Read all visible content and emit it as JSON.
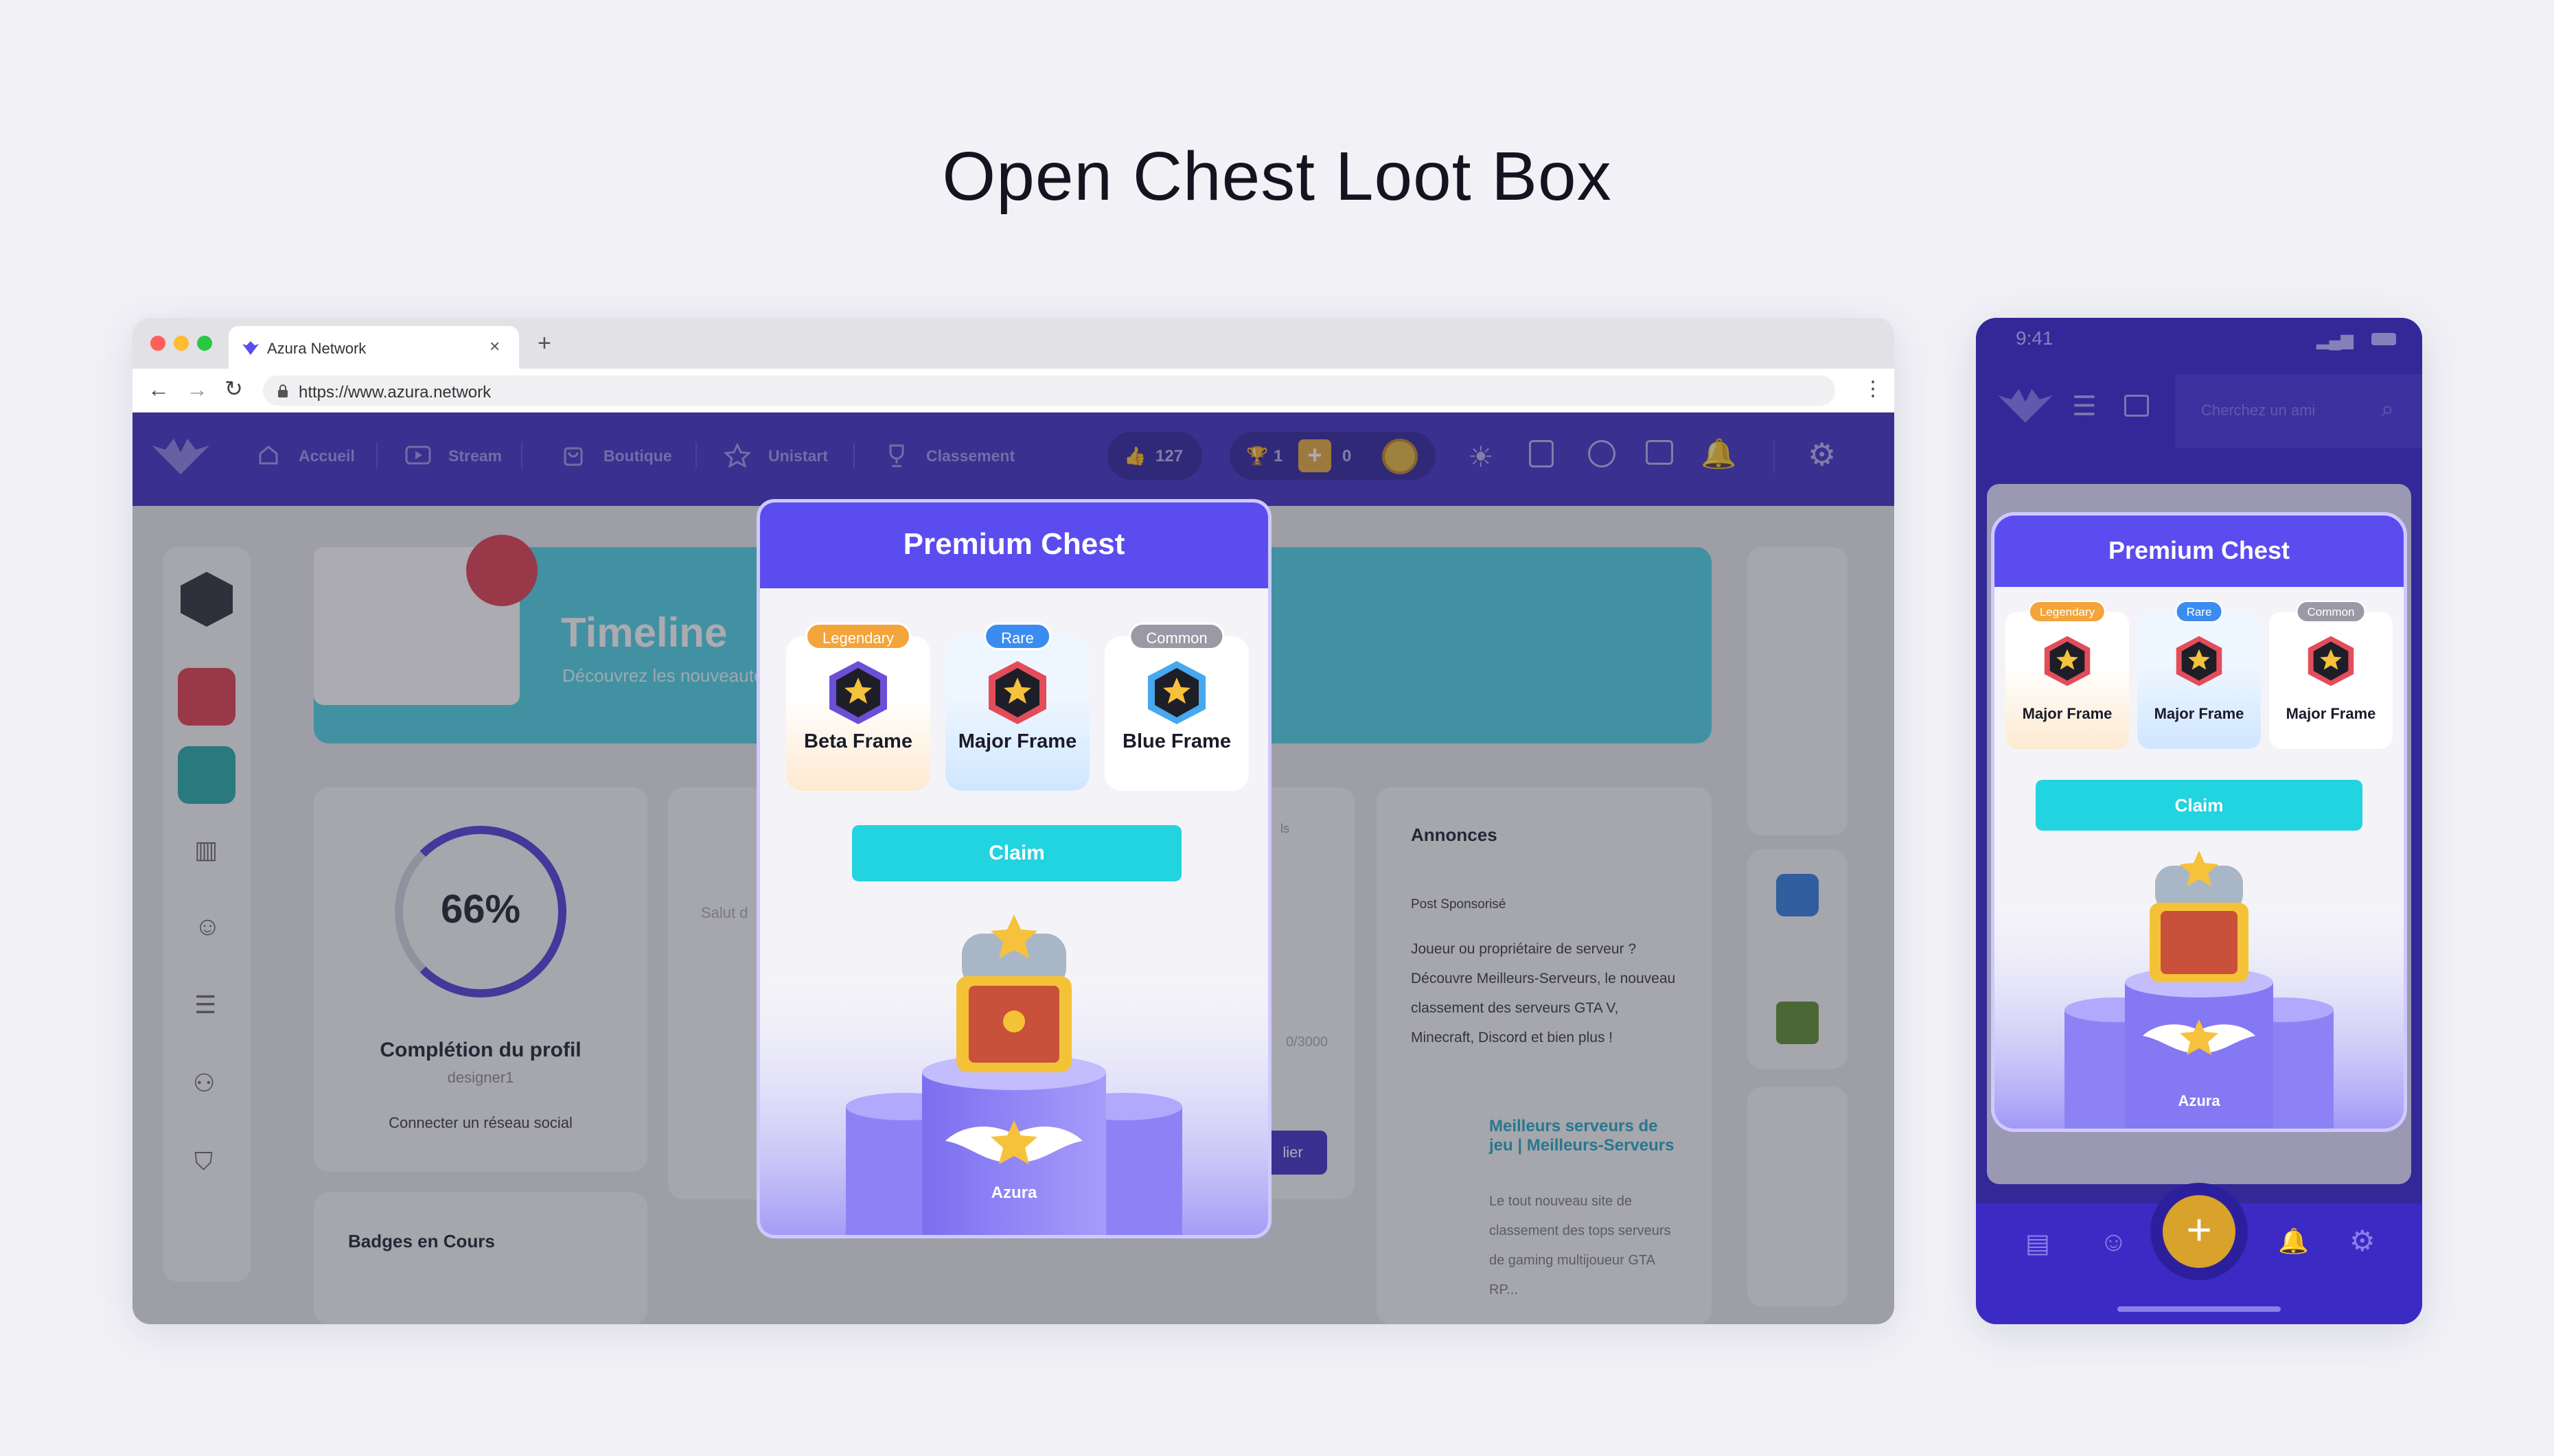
{
  "page": {
    "title": "Open Chest Loot Box"
  },
  "colors": {
    "brand": "#3b2bc4",
    "accent": "#5b4cf0",
    "claim": "#22d3e0",
    "legendary": "#f3a43a",
    "rare": "#3b8cf0",
    "common": "#9a9aa6"
  },
  "browser": {
    "tab_title": "Azura Network",
    "url": "https://www.azura.network",
    "nav": [
      {
        "label": "Accueil",
        "icon": "home-icon"
      },
      {
        "label": "Stream",
        "icon": "play-icon"
      },
      {
        "label": "Boutique",
        "icon": "bag-icon"
      },
      {
        "label": "Unistart",
        "icon": "star-icon"
      },
      {
        "label": "Classement",
        "icon": "trophy-icon"
      }
    ],
    "stats": {
      "likes": "127",
      "trophies": "1",
      "coins": "0"
    }
  },
  "background": {
    "timeline_title": "Timeline",
    "timeline_subtitle": "Découvrez les nouveauté",
    "profile_percent": "66%",
    "profile_title": "Complétion du profil",
    "profile_user": "designer1",
    "profile_link": "Connecter un réseau social",
    "badges_title": "Badges en Cours",
    "annonces_title": "Annonces",
    "annonces_sponsor": "Post Sponsorisé",
    "annonces_text": "Joueur ou propriétaire de serveur ? Découvre Meilleurs-Serveurs, le nouveau classement des serveurs GTA V, Minecraft, Discord et bien plus !",
    "annonces_link": "Meilleurs serveurs de jeu | Meilleurs-Serveurs",
    "annonces_desc": "Le tout nouveau site de classement des tops serveurs de gaming multijoueur GTA RP...",
    "post_placeholder": "Salut d",
    "counter": "0/3000",
    "publish_label": "lier",
    "col_label": "ls"
  },
  "modal": {
    "title": "Premium Chest",
    "cards": [
      {
        "tier": "Legendary",
        "label": "Beta Frame",
        "tier_color": "#f3a43a"
      },
      {
        "tier": "Rare",
        "label": "Major Frame",
        "tier_color": "#3b8cf0"
      },
      {
        "tier": "Common",
        "label": "Blue Frame",
        "tier_color": "#9a9aa6"
      }
    ],
    "claim_label": "Claim",
    "chest_label": "Azura"
  },
  "phone": {
    "time": "9:41",
    "search_placeholder": "Cherchez un ami",
    "modal_title": "Premium Chest",
    "cards": [
      {
        "tier": "Legendary",
        "label": "Major Frame"
      },
      {
        "tier": "Rare",
        "label": "Major Frame"
      },
      {
        "tier": "Common",
        "label": "Major Frame"
      }
    ],
    "claim_label": "Claim",
    "chest_label": "Azura"
  }
}
